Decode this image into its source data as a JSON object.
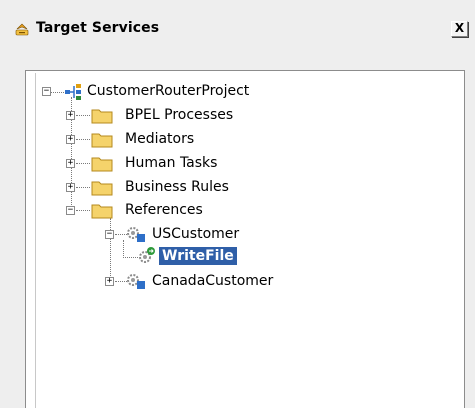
{
  "window": {
    "title": "Target Services",
    "close_label": "X"
  },
  "tree": {
    "root": {
      "label": "CustomerRouterProject",
      "expanded": true
    },
    "folders": [
      {
        "label": "BPEL Processes",
        "expanded": false
      },
      {
        "label": "Mediators",
        "expanded": false
      },
      {
        "label": "Human Tasks",
        "expanded": false
      },
      {
        "label": "Business Rules",
        "expanded": false
      },
      {
        "label": "References",
        "expanded": true
      }
    ],
    "references": [
      {
        "label": "USCustomer",
        "expanded": true
      },
      {
        "label": "CanadaCustomer",
        "expanded": false
      }
    ],
    "operation": {
      "label": "WriteFile",
      "selected": true
    }
  },
  "colors": {
    "selection": "#2f5fa8",
    "folder": "#f5d36b"
  }
}
